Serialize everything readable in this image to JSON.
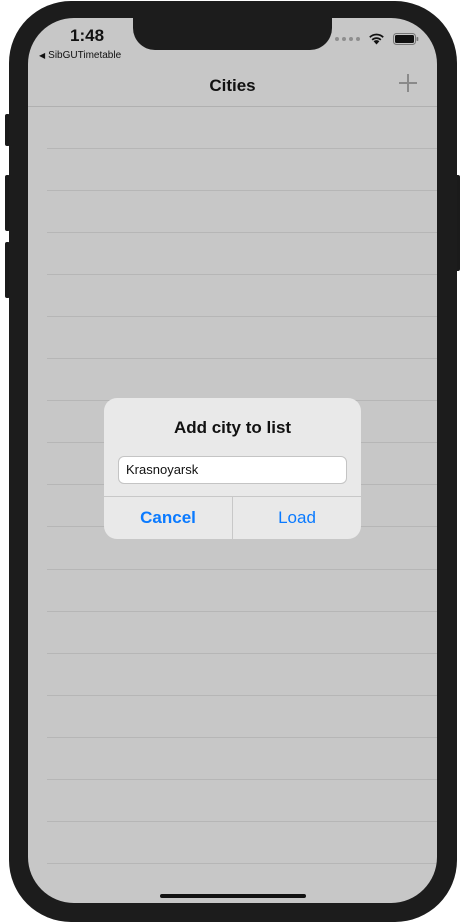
{
  "status_bar": {
    "time": "1:48",
    "back_app": "SibGUTimetable",
    "back_arrow": "◀",
    "wifi_icon": "wifi-icon",
    "battery_icon": "battery-icon"
  },
  "navbar": {
    "title": "Cities",
    "add_icon": "plus-icon"
  },
  "alert": {
    "title": "Add city to list",
    "input_value": "Krasnoyarsk",
    "cancel_label": "Cancel",
    "load_label": "Load"
  },
  "colors": {
    "accent": "#0a7aff",
    "background": "#c7c7c7",
    "alert_bg": "#e9e9e9"
  }
}
